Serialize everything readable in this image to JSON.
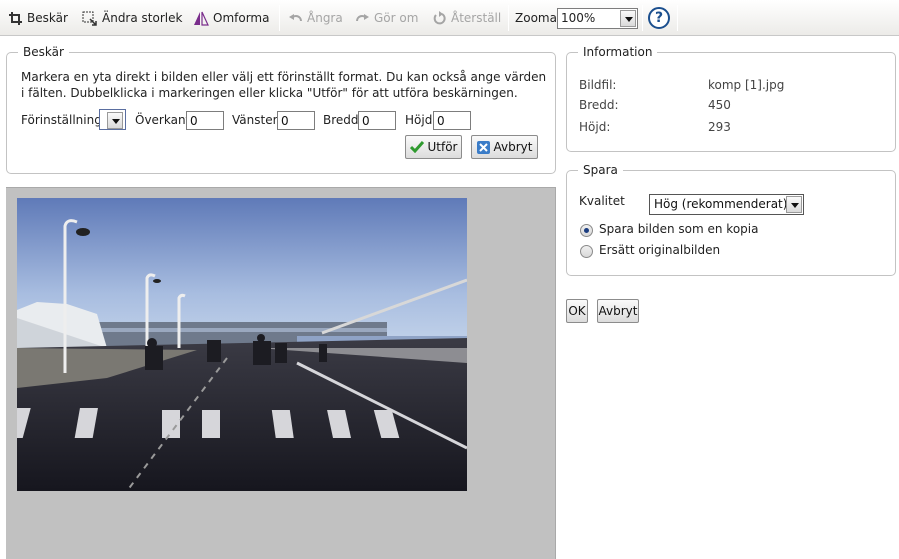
{
  "toolbar": {
    "crop": "Beskär",
    "resize": "Ändra storlek",
    "transform": "Omforma",
    "undo": "Ångra",
    "redo": "Gör om",
    "reset": "Återställ",
    "zoom_label": "Zooma",
    "zoom_value": "100%",
    "help": "?"
  },
  "crop": {
    "legend": "Beskär",
    "instructions": "Markera en yta direkt i bilden eller välj ett förinställt format. Du kan också ange värden i fälten. Dubbelklicka i markeringen eller klicka \"Utför\" för att utföra beskärningen.",
    "preset_label": "Förinställning",
    "top_label": "Överkant",
    "top_value": "0",
    "left_label": "Vänster",
    "left_value": "0",
    "width_label": "Bredd",
    "width_value": "0",
    "height_label": "Höjd",
    "height_value": "0",
    "apply": "Utför",
    "cancel": "Avbryt"
  },
  "information": {
    "legend": "Information",
    "rows": [
      {
        "label": "Bildfil:",
        "value": "komp [1].jpg"
      },
      {
        "label": "Bredd:",
        "value": "450"
      },
      {
        "label": "Höjd:",
        "value": "293"
      }
    ]
  },
  "save": {
    "legend": "Spara",
    "quality_label": "Kvalitet",
    "quality_value": "Hög (rekommenderat)",
    "option_copy": "Spara bilden som en kopia",
    "option_replace": "Ersätt originalbilden",
    "selected": "copy"
  },
  "actions": {
    "ok": "OK",
    "cancel": "Avbryt"
  },
  "icons": [
    "crop-icon",
    "resize-icon",
    "transform-icon",
    "undo-icon",
    "redo-icon",
    "reset-icon",
    "help-icon",
    "check-icon",
    "cancel-x-icon"
  ],
  "colors": {
    "toolbar_bg": "#ecebe8",
    "canvas_bg": "#c1c1c1",
    "help_blue": "#1b4f8e",
    "check_green": "#2e9a2e",
    "cancel_blue": "#3a7cc8",
    "transform_purple": "#7a2d8c"
  }
}
